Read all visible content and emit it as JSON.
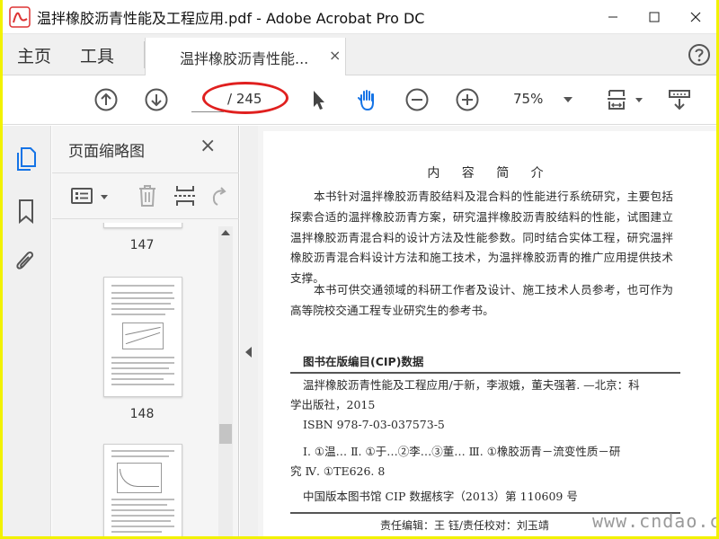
{
  "window": {
    "title": "温拌橡胶沥青性能及工程应用.pdf - Adobe Acrobat Pro DC"
  },
  "menu": {
    "home": "主页",
    "tools": "工具"
  },
  "tab": {
    "label": "温拌橡胶沥青性能...",
    "close": "×"
  },
  "toolbar": {
    "page_total": "/ 245",
    "page_current": "",
    "zoom": "75%"
  },
  "thumbnail_panel": {
    "title": "页面缩略图",
    "close": "×",
    "pages": [
      {
        "label": "147"
      },
      {
        "label": "148"
      }
    ]
  },
  "document": {
    "heading": "内 容 简 介",
    "paragraph_1": "本书针对温拌橡胶沥青胶结料及混合料的性能进行系统研究，主要包括探索合适的温拌橡胶沥青方案，研究温拌橡胶沥青胶结料的性能，试图建立温拌橡胶沥青混合料的设计方法及性能参数。同时结合实体工程，研究温拌橡胶沥青混合料设计方法和施工技术，为温拌橡胶沥青的推广应用提供技术支撑。",
    "paragraph_2": "本书可供交通领域的科研工作者及设计、施工技术人员参考，也可作为高等院校交通工程专业研究生的参考书。",
    "cip_title": "图书在版编目(CIP)数据",
    "cip_line_1": "温拌橡胶沥青性能及工程应用/于新，李淑娥，董夫强著. —北京：科",
    "cip_line_2": "学出版社，2015",
    "cip_line_3": "ISBN 978-7-03-037573-5",
    "cip_line_4": "Ⅰ. ①温… Ⅱ. ①于…②李…③董… Ⅲ. ①橡胶沥青－流变性质－研",
    "cip_line_5": "究 Ⅳ. ①TE626. 8",
    "cip_line_6": "中国版本图书馆 CIP 数据核字（2013）第 110609 号",
    "editor_line": "责任编辑：王 钰/责任校对：刘玉靖"
  },
  "watermark": "www.cndao.com",
  "colors": {
    "border_yellow": "#f2f200",
    "annotation_red": "#e0201f",
    "accent_blue": "#1473e6"
  }
}
